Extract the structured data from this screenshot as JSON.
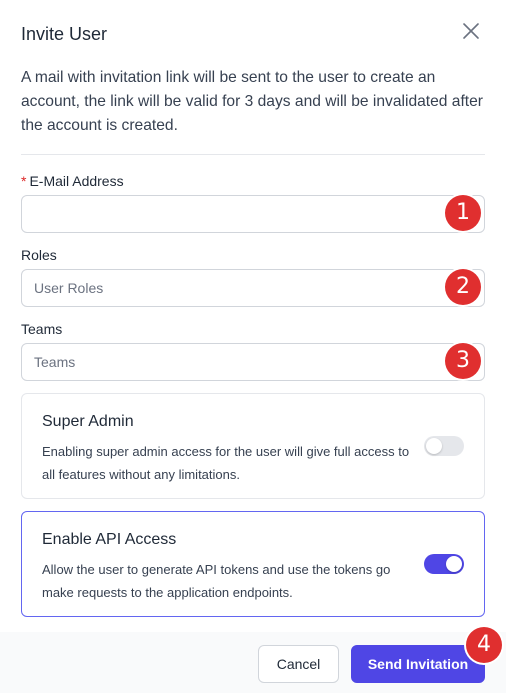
{
  "dialog": {
    "title": "Invite User",
    "description": "A mail with invitation link will be sent to the user to create an account, the link will be valid for 3 days and will be invalidated after the account is created."
  },
  "fields": {
    "email": {
      "required_mark": "*",
      "label": "E-Mail Address",
      "value": "",
      "badge": "1"
    },
    "roles": {
      "label": "Roles",
      "placeholder": "User Roles",
      "badge": "2"
    },
    "teams": {
      "label": "Teams",
      "placeholder": "Teams",
      "badge": "3"
    }
  },
  "options": {
    "super_admin": {
      "title": "Super Admin",
      "description": "Enabling super admin access for the user will give full access to all features without any limitations.",
      "enabled": false
    },
    "api_access": {
      "title": "Enable API Access",
      "description": "Allow the user to generate API tokens and use the tokens go make requests to the application endpoints.",
      "enabled": true
    }
  },
  "footer": {
    "cancel_label": "Cancel",
    "send_label": "Send Invitation",
    "badge": "4"
  },
  "colors": {
    "accent": "#4f46e5",
    "badge": "#e02f2f",
    "required": "#dc2626"
  }
}
